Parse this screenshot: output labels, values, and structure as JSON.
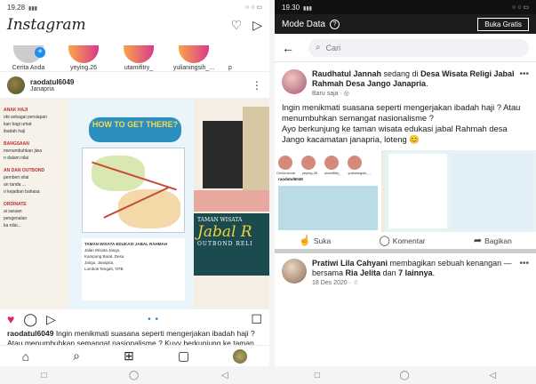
{
  "left": {
    "status_time": "19.28",
    "status_signal": "  ",
    "status_right": "○ ○ ▭",
    "logo": "Instagram",
    "header_icons": {
      "heart": "♡",
      "send": "▷"
    },
    "stories": [
      {
        "name": "Cerita Anda",
        "own": true
      },
      {
        "name": "yeying.26"
      },
      {
        "name": "utamifitry_"
      },
      {
        "name": "yulianingsih_..."
      },
      {
        "name": "p"
      }
    ],
    "post": {
      "username": "raodatul6049",
      "location": "Janapria",
      "more": "⋮",
      "image": {
        "col1_lines": [
          "ANAK HAJI",
          "",
          "obi sebagai persiapan",
          "kan bagi umat",
          "ibadah haji",
          "",
          "BANGSAAN",
          "",
          "menumbuhkan jiwa",
          "n dalam nilai",
          "",
          "AN DAN OUTBOND",
          "",
          "pemberi nilai",
          "an tanda ...",
          "ri kejadian bahasa",
          "",
          "ORDINATE",
          "",
          "ai saraan",
          "pengenalan",
          "ka nilai..."
        ],
        "how_to": "HOW TO GET THERE?",
        "info_title": "TAMAN WISATA EDUKASI JABAL RAHMAH",
        "info_lines": [
          "Jalan Wisata Jango,",
          "Kampung Barat, Desa",
          "Jango, Janapria,",
          "Lombok Tengah, NTB"
        ],
        "banner_top": "TAMAN WISATA",
        "banner_main": "Jabal R",
        "banner_bottom": "OUTBOND RELI"
      },
      "actions": {
        "like": "♥",
        "comment": "◯",
        "share": "▷",
        "pager": "• •",
        "save": "☐"
      },
      "caption_user": "raodatul6049",
      "caption_text": " Ingin menikmati suasana seperti mengerjakan ibadah haji ? Atau menumbuhkan semangat nasionalisme ? Kuyy berkunjung ke taman wisata edukasi jabal"
    },
    "nav": {
      "home": "⌂",
      "search": "⌕",
      "add": "⊞",
      "reels": "▢"
    },
    "sysnav": [
      "□",
      "◯",
      "◁"
    ]
  },
  "right": {
    "status_time": "19.30",
    "status_signal": " ",
    "status_right": "○ ○ ▭",
    "mode_label": "Mode Data",
    "mode_help": "?",
    "upgrade_button": "Buka Gratis",
    "back": "←",
    "search_icon": "⌕",
    "search_placeholder": "Cari",
    "post": {
      "author": "Raudhatul Jannah",
      "verb": " sedang di ",
      "place": "Desa Wisata Religi Jabal Rahmah Desa Jango Janapria",
      "dot": ".",
      "time": "Baru saja",
      "privacy": "· ◎",
      "more": "•••",
      "text1": "Ingin menikmati suasana seperti mengerjakan ibadah haji ? Atau menumbuhkan semangat nasionalisme ?",
      "text2": "Ayo berkunjung ke taman wisata edukasi jabal Rahmah desa Jango kacamatan janapria, loteng 😊",
      "shot_labels": [
        "Cerita Anda",
        "yeying.26",
        "utamifitry_",
        "yulianingsih_..."
      ],
      "shot_user": "raodatul6049",
      "actions": [
        {
          "icon": "☝",
          "label": "Suka"
        },
        {
          "icon": "◯",
          "label": "Komentar"
        },
        {
          "icon": "➦",
          "label": "Bagikan"
        }
      ]
    },
    "post2": {
      "author": "Pratiwi Lila Cahyani",
      "verb": " membagikan sebuah kenangan — bersama ",
      "with": "Ria Jelita",
      "and": " dan ",
      "others": "7 lainnya",
      "end": ".",
      "date": "18 Des 2020",
      "privacy": "· ☃",
      "more": "•••"
    },
    "sysnav": [
      "□",
      "◯",
      "◁"
    ]
  }
}
